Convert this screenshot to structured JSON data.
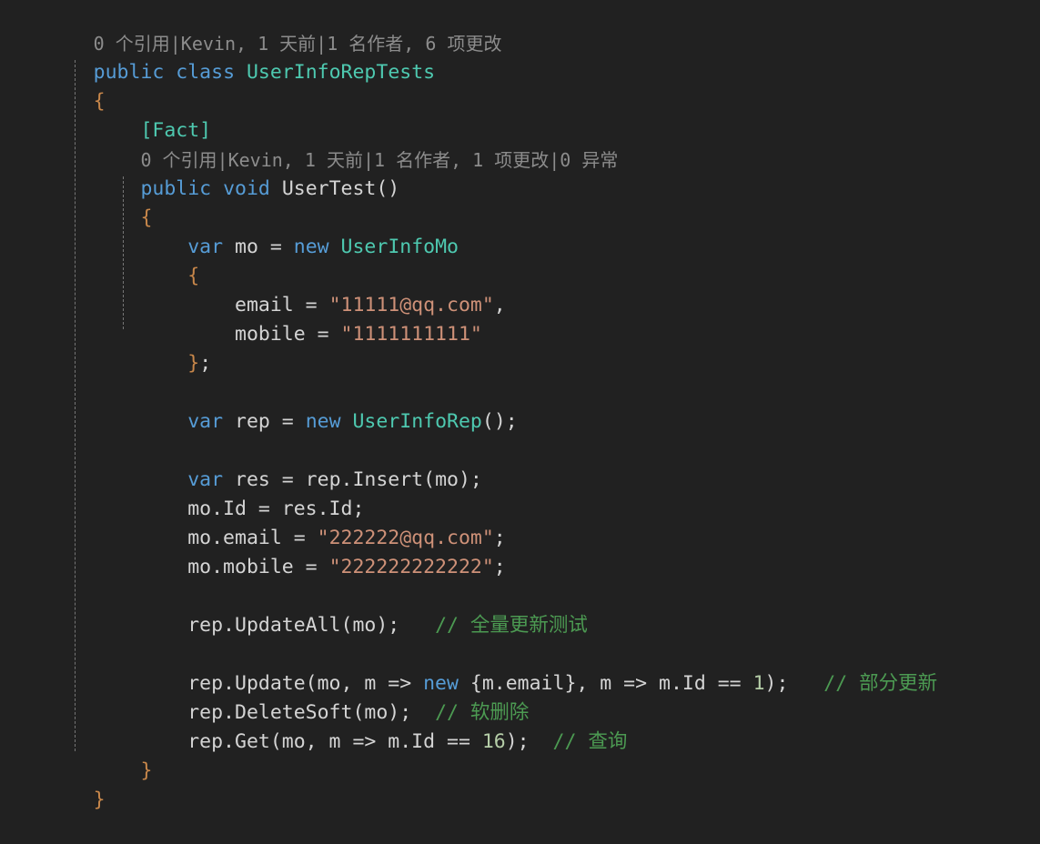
{
  "editor": {
    "background_color": "#212121",
    "language": "csharp",
    "colors": {
      "keyword": "#569CD6",
      "type": "#4EC9B0",
      "string": "#CE9178",
      "comment": "#4C9A52",
      "brace": "#C8874A",
      "plain": "#D4D4D4",
      "codelens": "#8C8C8C",
      "indent_guide": "#767676"
    }
  },
  "codelens": [
    {
      "references": "0 个引用",
      "author_changed": "Kevin, 1 天前",
      "authors_changes": "1 名作者, 6 项更改",
      "exceptions": "",
      "full": "0 个引用|Kevin, 1 天前|1 名作者, 6 项更改"
    },
    {
      "references": "0 个引用",
      "author_changed": "Kevin, 1 天前",
      "authors_changes": "1 名作者, 1 项更改",
      "exceptions": "0 异常",
      "full": "0 个引用|Kevin, 1 天前|1 名作者, 1 项更改|0 异常"
    }
  ],
  "code_lines": [
    {
      "id": "lens-class",
      "kind": "codelens",
      "text": "0 个引用|Kevin, 1 天前|1 名作者, 6 项更改"
    },
    {
      "id": "class-decl",
      "kind": "code",
      "text": "public class UserInfoRepTests"
    },
    {
      "id": "class-open-brace",
      "kind": "code",
      "text": "{"
    },
    {
      "id": "fact-attribute",
      "kind": "code",
      "text": "    [Fact]"
    },
    {
      "id": "lens-method",
      "kind": "codelens",
      "text": "    0 个引用|Kevin, 1 天前|1 名作者, 1 项更改|0 异常"
    },
    {
      "id": "method-decl",
      "kind": "code",
      "text": "    public void UserTest()"
    },
    {
      "id": "method-open-brace",
      "kind": "code",
      "text": "    {"
    },
    {
      "id": "var-mo",
      "kind": "code",
      "text": "        var mo = new UserInfoMo"
    },
    {
      "id": "init-open-brace",
      "kind": "code",
      "text": "        {"
    },
    {
      "id": "init-email",
      "kind": "code",
      "text": "            email = \"11111@qq.com\","
    },
    {
      "id": "init-mobile",
      "kind": "code",
      "text": "            mobile = \"1111111111\""
    },
    {
      "id": "init-close-brace",
      "kind": "code",
      "text": "        };"
    },
    {
      "id": "blank-1",
      "kind": "blank",
      "text": ""
    },
    {
      "id": "var-rep",
      "kind": "code",
      "text": "        var rep = new UserInfoRep();"
    },
    {
      "id": "blank-2",
      "kind": "blank",
      "text": ""
    },
    {
      "id": "var-res",
      "kind": "code",
      "text": "        var res = rep.Insert(mo);"
    },
    {
      "id": "assign-id",
      "kind": "code",
      "text": "        mo.Id = res.Id;"
    },
    {
      "id": "assign-email",
      "kind": "code",
      "text": "        mo.email = \"222222@qq.com\";"
    },
    {
      "id": "assign-mobile",
      "kind": "code",
      "text": "        mo.mobile = \"222222222222\";"
    },
    {
      "id": "blank-3",
      "kind": "blank",
      "text": ""
    },
    {
      "id": "call-updateall",
      "kind": "code",
      "text": "        rep.UpdateAll(mo);   // 全量更新测试"
    },
    {
      "id": "blank-4",
      "kind": "blank",
      "text": ""
    },
    {
      "id": "call-update",
      "kind": "code",
      "text": "        rep.Update(mo, m => new {m.email}, m => m.Id == 1);   // 部分更新"
    },
    {
      "id": "call-deletesoft",
      "kind": "code",
      "text": "        rep.DeleteSoft(mo);  // 软删除"
    },
    {
      "id": "call-get",
      "kind": "code",
      "text": "        rep.Get(mo, m => m.Id == 16);  // 查询"
    },
    {
      "id": "method-close-brace",
      "kind": "code",
      "text": "    }"
    },
    {
      "id": "class-close-brace",
      "kind": "code",
      "text": "}"
    }
  ],
  "tokens": {
    "kw_public": "public",
    "kw_class": "class",
    "kw_void": "void",
    "kw_var": "var",
    "kw_new": "new",
    "type_userinforeptests": "UserInfoRepTests",
    "type_userinfomo": "UserInfoMo",
    "type_userinforep": "UserInfoRep",
    "attr_fact": "[Fact]",
    "method_usertest": "UserTest()",
    "str_email_1": "\"11111@qq.com\"",
    "str_mobile_1": "\"1111111111\"",
    "str_email_2": "\"222222@qq.com\"",
    "str_mobile_2": "\"222222222222\"",
    "cmt_updateall": "// 全量更新测试",
    "cmt_update": "// 部分更新",
    "cmt_deletesoft": "// 软删除",
    "cmt_get": "// 查询",
    "num_1": "1",
    "num_16": "16",
    "brace_open": "{",
    "brace_close": "}",
    "lens_sep": "|"
  }
}
